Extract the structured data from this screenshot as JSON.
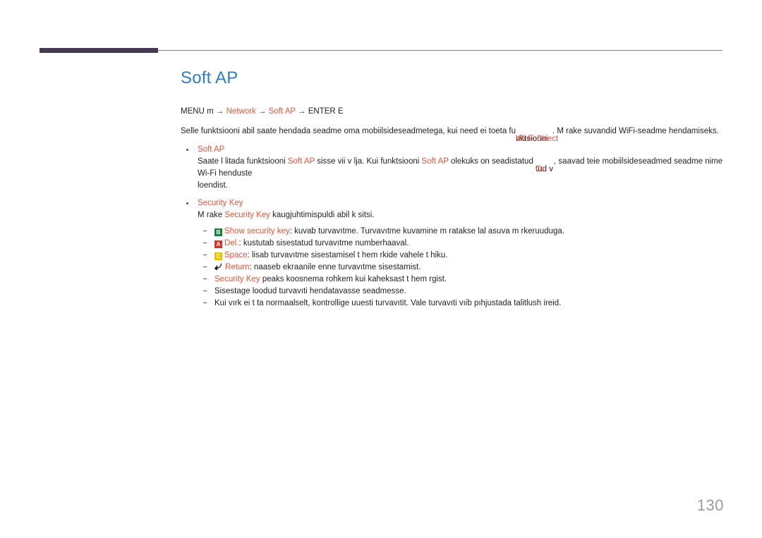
{
  "theme": {
    "title_color": "#2e7ec4",
    "accent_color": "#e8553a",
    "text_color": "#231f20",
    "rule_bar_color": "#453a52",
    "rule_line_color": "#7c7c85",
    "page_number_color": "#9a9aa2",
    "key_green": "#1f7a3d",
    "key_red": "#e03127",
    "key_yellow": "#f0c000"
  },
  "header": {
    "rule_name": "section-rule"
  },
  "title": "Soft AP",
  "menu_path": {
    "prefix": "MENU",
    "menu_key": "m",
    "arrow": "→",
    "item1": "Network",
    "item2": "Soft AP",
    "suffix": "ENTER",
    "enter_key": "E"
  },
  "intro": {
    "part1": "Selle funktsiooni abil saate  hendada seadme oma mobiilsideseadmetega, kui need ei toeta fu",
    "overlap_under": "nktsiooni",
    "overlap_over": "Wi-Fi Direct",
    "part2": ". M  rake suvandid WiFi-seadme  hendamiseks."
  },
  "bullets": [
    {
      "heading": "Soft AP",
      "body_before": "Saate l litada funktsiooni ",
      "body_accent1": "Soft AP",
      "body_mid": " sisse vii v lja. Kui funktsiooni ",
      "body_accent2": "Soft AP",
      "body_after": " olekuks on seadistatud ",
      "overlap_under": "tud v",
      "overlap_over": "On",
      "body_tail": ", saavad teie mobiilsideseadmed seadme nime Wi-Fi  henduste",
      "body_line2": "loendist."
    },
    {
      "heading": "Security Key",
      "body_before": "M  rake ",
      "body_accent1": "Security Key",
      "body_after": " kaugjuhtimispuldi abil k sitsi."
    }
  ],
  "sub_items": [
    {
      "key_badge": "B",
      "badge_color": "green",
      "icon": "key-b-badge-icon",
      "label": "Show security key",
      "text": ": kuvab turvavıtme. Turvavıtme kuvamine m  ratakse  lal asuva m rkeruuduga."
    },
    {
      "key_badge": "A",
      "badge_color": "red",
      "icon": "key-a-badge-icon",
      "label": "Del.",
      "text": ": kustutab sisestatud turvavıtme numberhaaval."
    },
    {
      "key_badge": "C",
      "badge_color": "yellow",
      "icon": "key-c-badge-icon",
      "label": "Space",
      "text": ": lisab turvavıtme sisestamisel t hem rkide vahele t hiku."
    },
    {
      "key_badge": "",
      "badge_color": "return",
      "icon": "return-arrow-icon",
      "label": "Return",
      "text": ": naaseb ekraanile enne turvavıtme sisestamist."
    },
    {
      "key_badge": "",
      "badge_color": "none",
      "icon": "",
      "label": "Security Key",
      "text": " peaks koosnema rohkem kui kaheksast t hem rgist."
    },
    {
      "key_badge": "",
      "badge_color": "none",
      "icon": "",
      "label": "",
      "text": "Sisestage loodud turvavıti  hendatavasse seadmesse."
    },
    {
      "key_badge": "",
      "badge_color": "none",
      "icon": "",
      "label": "",
      "text": "Kui vırk ei t  ta normaalselt, kontrollige uuesti turvavıtit. Vale turvavıti vıib pıhjustada talitlush ireid."
    }
  ],
  "page_number": "130"
}
